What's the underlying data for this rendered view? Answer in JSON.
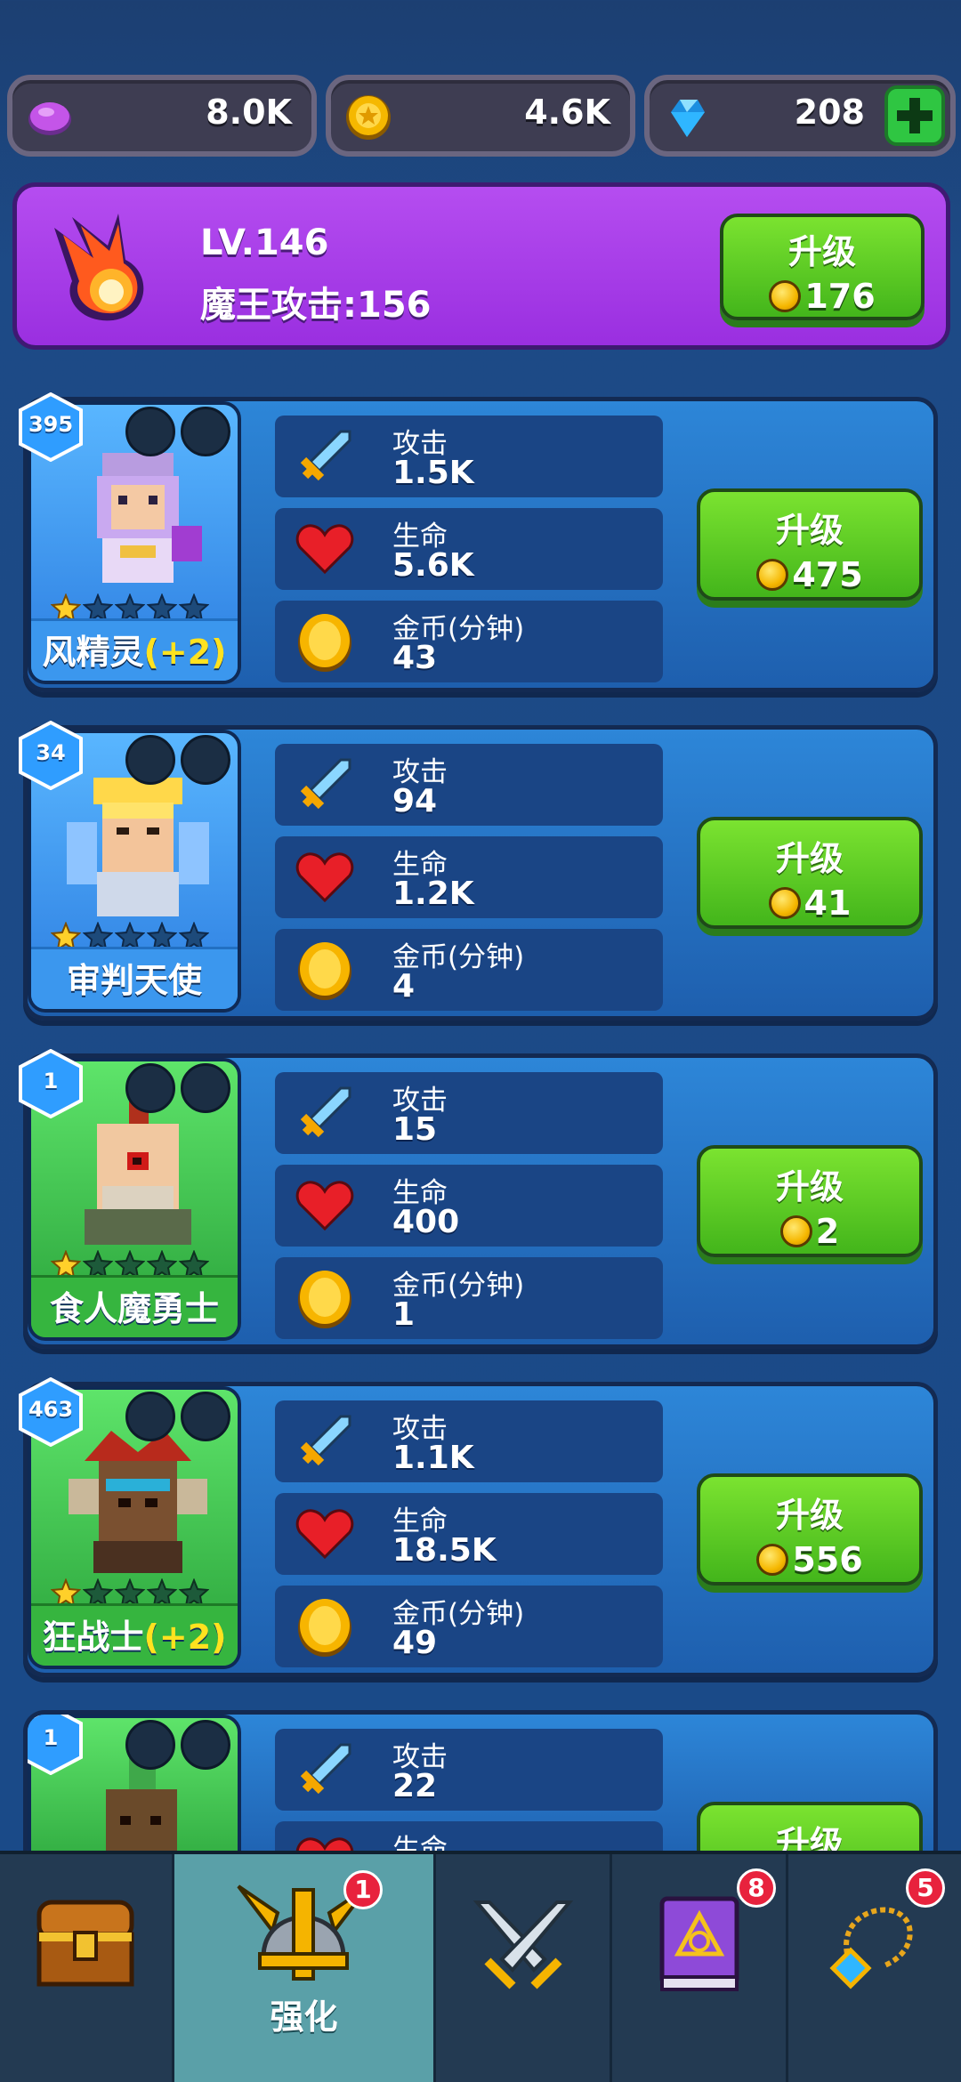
{
  "currencies": [
    {
      "icon": "purple-gem-icon",
      "value": "8.0K"
    },
    {
      "icon": "gold-coin-icon",
      "value": "4.6K"
    },
    {
      "icon": "diamond-icon",
      "value": "208"
    }
  ],
  "boss": {
    "level": "LV.146",
    "attack": "魔王攻击:156",
    "upgrade_label": "升级",
    "upgrade_cost": "176"
  },
  "stat_labels": {
    "attack": "攻击",
    "hp": "生命",
    "gold": "金币(分钟)"
  },
  "heroes": [
    {
      "name": "风精灵",
      "bonus": "(+2)",
      "level": "395",
      "stars": 1,
      "attack": "1.5K",
      "hp": "5.6K",
      "gold": "43",
      "upgrade_label": "升级",
      "cost": "475",
      "rarity": "blue"
    },
    {
      "name": "审判天使",
      "bonus": "",
      "level": "34",
      "stars": 1,
      "attack": "94",
      "hp": "1.2K",
      "gold": "4",
      "upgrade_label": "升级",
      "cost": "41",
      "rarity": "blue"
    },
    {
      "name": "食人魔勇士",
      "bonus": "",
      "level": "1",
      "stars": 1,
      "attack": "15",
      "hp": "400",
      "gold": "1",
      "upgrade_label": "升级",
      "cost": "2",
      "rarity": "green"
    },
    {
      "name": "狂战士",
      "bonus": "(+2)",
      "level": "463",
      "stars": 1,
      "attack": "1.1K",
      "hp": "18.5K",
      "gold": "49",
      "upgrade_label": "升级",
      "cost": "556",
      "rarity": "green"
    },
    {
      "level": "1",
      "attack": "22",
      "upgrade_label": "升级",
      "rarity": "green"
    }
  ],
  "nav": {
    "tabs": [
      {
        "icon": "treasure-chest-icon",
        "label": "",
        "badge": ""
      },
      {
        "icon": "viking-helmet-icon",
        "label": "强化",
        "badge": "1"
      },
      {
        "icon": "crossed-swords-icon",
        "label": "",
        "badge": ""
      },
      {
        "icon": "spellbook-icon",
        "label": "",
        "badge": "8"
      },
      {
        "icon": "amulet-icon",
        "label": "",
        "badge": "5"
      }
    ]
  },
  "colors": {
    "background": "#1d4a86",
    "boss_panel": "#a83ce8",
    "upgrade_green": "#5ccb24",
    "active_tab": "#5aa0a8",
    "badge_red": "#e8223d"
  }
}
